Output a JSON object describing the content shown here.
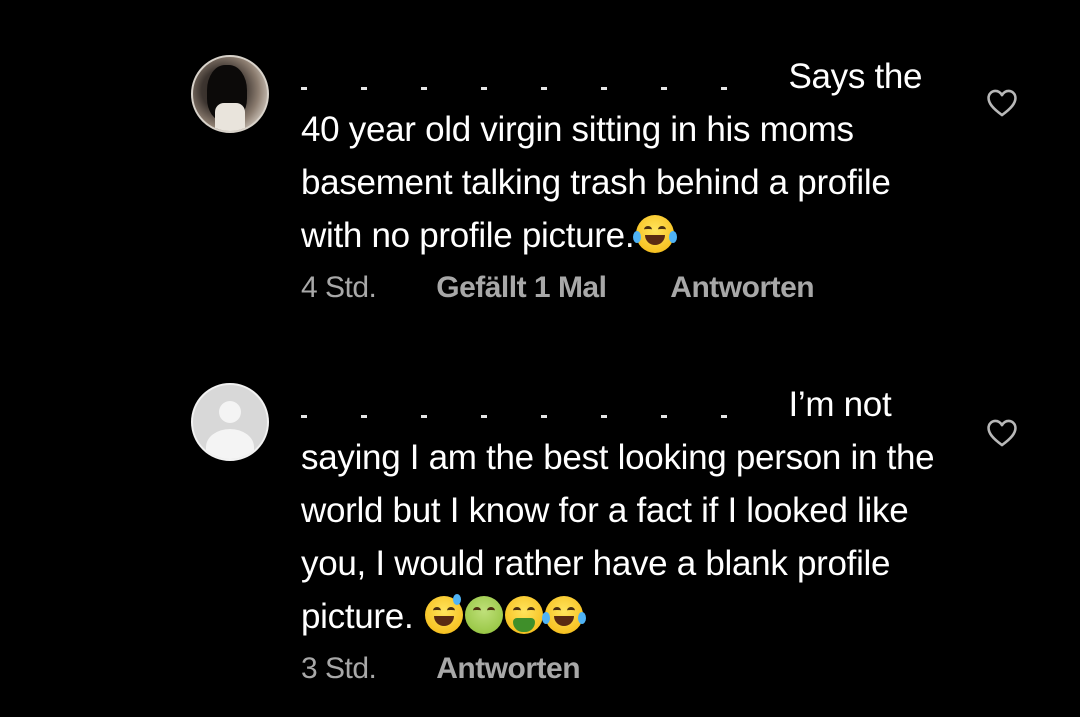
{
  "comments": [
    {
      "text": "Says the 40 year old virgin sitting in his moms basement talking trash behind a profile with no profile picture.",
      "emojis": [
        "face-with-tears-of-joy"
      ],
      "time": "4 Std.",
      "likes": "Gefällt 1 Mal",
      "reply": "Antworten",
      "avatar": "profile-photo"
    },
    {
      "text_line1": "I’m not",
      "text_rest": "saying I am the best looking person in the world but I know for a fact if I looked like you, I would rather have a blank profile picture.",
      "emojis": [
        "grinning-face-with-sweat",
        "nauseated-face",
        "face-vomiting",
        "face-with-tears-of-joy"
      ],
      "time": "3 Std.",
      "reply": "Antworten",
      "avatar": "default-avatar"
    }
  ],
  "icons": {
    "like": "heart-outline-icon"
  },
  "colors": {
    "background": "#000000",
    "text": "#ffffff",
    "meta": "#a8a8a8"
  }
}
